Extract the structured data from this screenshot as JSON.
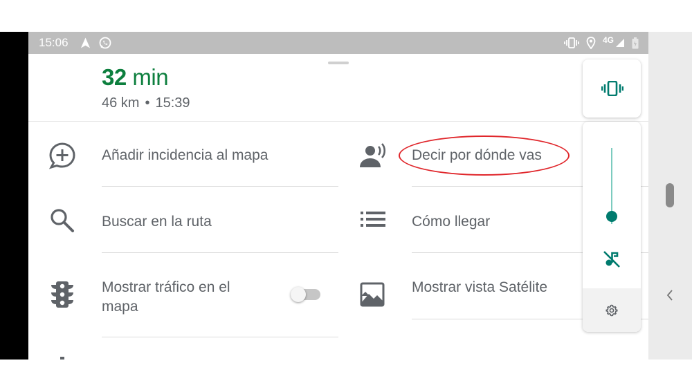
{
  "status_bar": {
    "time": "15:06",
    "network": "4G",
    "icons": [
      "navigation-icon",
      "whatsapp-icon",
      "vibrate-icon",
      "location-icon",
      "signal-icon",
      "battery-icon"
    ]
  },
  "trip": {
    "duration_value": "32",
    "duration_unit": "min",
    "distance": "46 km",
    "separator": "•",
    "arrival": "15:39"
  },
  "menu": {
    "add_incident": {
      "label": "Añadir incidencia al mapa",
      "icon": "add-report-icon"
    },
    "share_location": {
      "label": "Decir por dónde vas",
      "icon": "voice-share-icon"
    },
    "search_route": {
      "label": "Buscar en la ruta",
      "icon": "search-icon"
    },
    "directions": {
      "label": "Cómo llegar",
      "icon": "list-icon"
    },
    "traffic": {
      "label_line1": "Mostrar tráfico en el",
      "label_line2": "mapa",
      "icon": "traffic-light-icon",
      "toggle_on": false
    },
    "satellite": {
      "label": "Mostrar vista Satélite",
      "icon": "satellite-image-icon"
    }
  },
  "volume_panel": {
    "mode_icon": "vibrate-icon",
    "level": 0.1,
    "mute_icon": "music-off-icon",
    "settings_icon": "gear-icon"
  },
  "colors": {
    "eta_green": "#0d7f3e",
    "accent_teal": "#007b6e",
    "text_gray": "#5f6368",
    "status_bar": "#bdbdbd",
    "highlight_red": "#e0262b"
  }
}
